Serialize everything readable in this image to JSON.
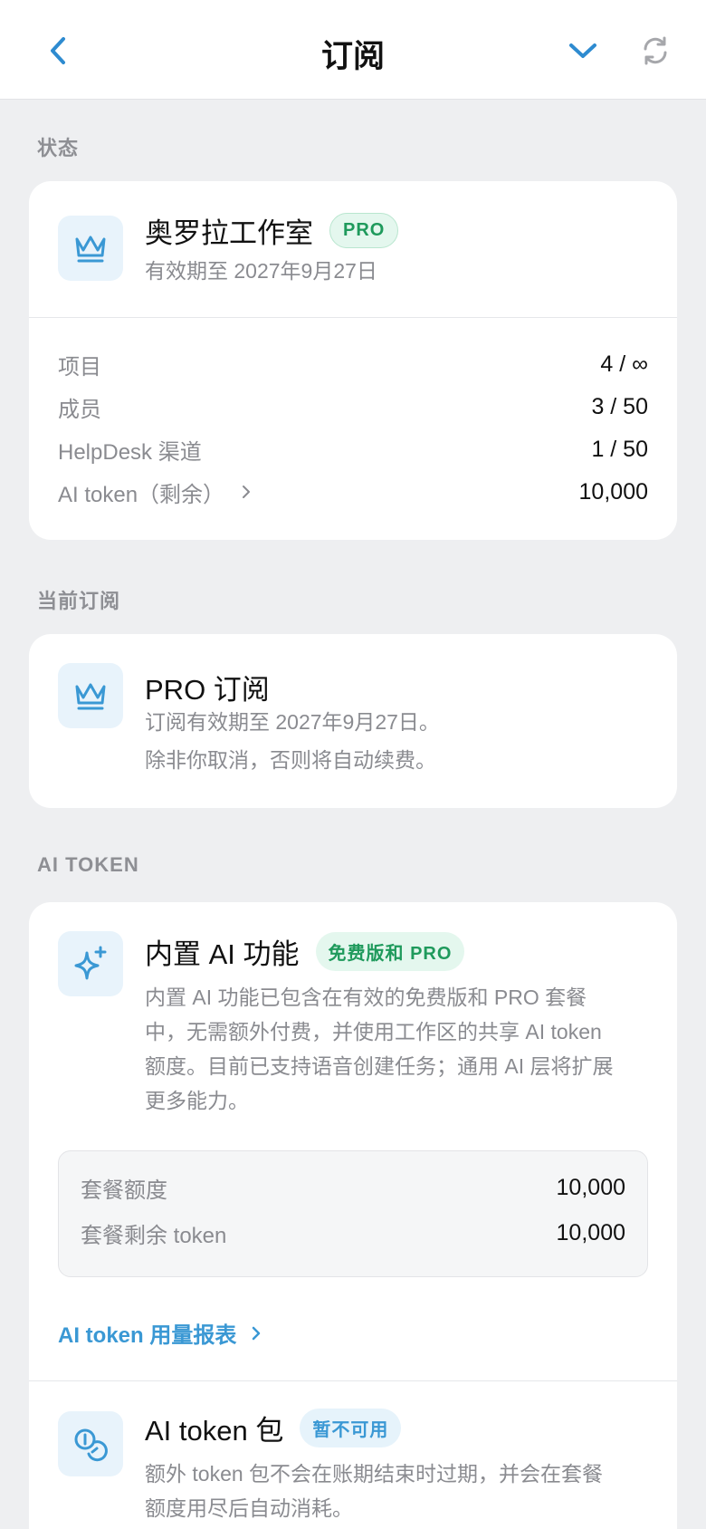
{
  "header": {
    "title": "订阅",
    "icons": [
      "chevron-left-icon",
      "chevron-down-icon",
      "refresh-icon"
    ],
    "accent_color": "#2e8bd0"
  },
  "status": {
    "section_label": "状态",
    "workspace_name": "奥罗拉工作室",
    "plan_badge": "PRO",
    "valid_until": "有效期至 2027年9月27日",
    "rows": [
      {
        "label": "项目",
        "value": "4 / ∞"
      },
      {
        "label": "成员",
        "value": "3 / 50"
      },
      {
        "label": "HelpDesk 渠道",
        "value": "1 / 50"
      },
      {
        "label": "AI token（剩余）",
        "value": "10,000"
      }
    ]
  },
  "current_subscription": {
    "section_label": "当前订阅",
    "title": "PRO 订阅",
    "line1": "订阅有效期至 2027年9月27日。",
    "line2": "除非你取消，否则将自动续费。"
  },
  "ai_token": {
    "section_label": "AI TOKEN",
    "builtin": {
      "title": "内置 AI 功能",
      "badge": "免费版和 PRO",
      "desc_lines": [
        "内置 AI 功能已包含在有效的免费版和 PRO 套餐",
        "中，无需额外付费，并使用工作区的共享 AI token",
        "额度。目前已支持语音创建任务；通用 AI 层将扩展",
        "更多能力。"
      ]
    },
    "quota": [
      {
        "label": "套餐额度",
        "value": "10,000"
      },
      {
        "label": "套餐剩余 token",
        "value": "10,000"
      }
    ],
    "report_link": "AI token 用量报表",
    "pack": {
      "title": "AI token 包",
      "badge": "暂不可用",
      "desc_lines": [
        "额外 token 包不会在账期结束时过期，并会在套餐",
        "额度用尽后自动消耗。"
      ]
    }
  },
  "colors": {
    "pro_green": "#1f9a5c",
    "link_blue": "#3a98d4",
    "icon_bg": "#e8f3fb"
  }
}
